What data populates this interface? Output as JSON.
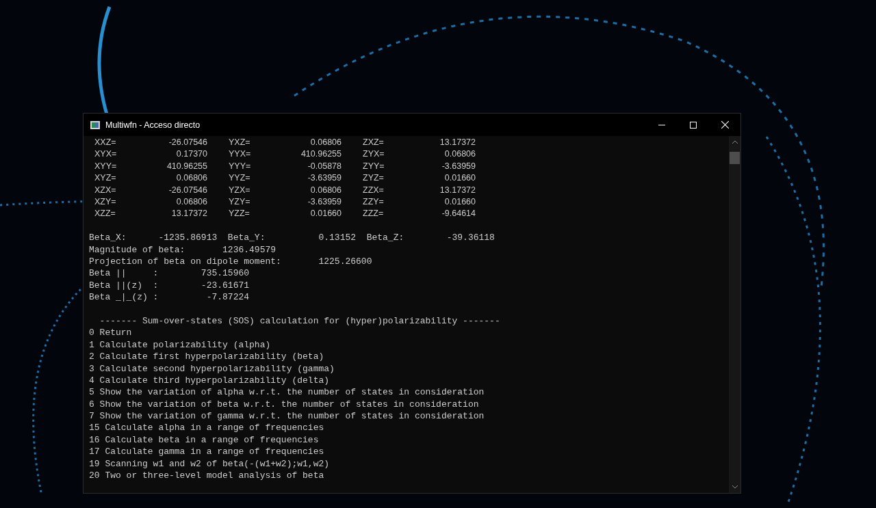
{
  "window": {
    "title": "Multiwfn - Acceso directo"
  },
  "console": {
    "tensor_rows": [
      [
        "XXZ=",
        "-26.07546",
        "YXZ=",
        "0.06806",
        "ZXZ=",
        "13.17372"
      ],
      [
        "XYX=",
        "0.17370",
        "YYX=",
        "410.96255",
        "ZYX=",
        "0.06806"
      ],
      [
        "XYY=",
        "410.96255",
        "YYY=",
        "-0.05878",
        "ZYY=",
        "-3.63959"
      ],
      [
        "XYZ=",
        "0.06806",
        "YYZ=",
        "-3.63959",
        "ZYZ=",
        "0.01660"
      ],
      [
        "XZX=",
        "-26.07546",
        "YZX=",
        "0.06806",
        "ZZX=",
        "13.17372"
      ],
      [
        "XZY=",
        "0.06806",
        "YZY=",
        "-3.63959",
        "ZZY=",
        "0.01660"
      ],
      [
        "XZZ=",
        "13.17372",
        "YZZ=",
        "0.01660",
        "ZZZ=",
        "-9.64614"
      ]
    ],
    "blocks": [
      [
        "Beta_X:      -1235.86913  Beta_Y:          0.13152  Beta_Z:        -39.36118",
        "Magnitude of beta:       1236.49579",
        "Projection of beta on dipole moment:       1225.26600",
        "Beta ||     :        735.15960",
        "Beta ||(z)  :        -23.61671",
        "Beta _|_(z) :         -7.87224"
      ],
      [
        "  ------- Sum-over-states (SOS) calculation for (hyper)polarizability -------",
        "0 Return",
        "1 Calculate polarizability (alpha)",
        "2 Calculate first hyperpolarizability (beta)",
        "3 Calculate second hyperpolarizability (gamma)",
        "4 Calculate third hyperpolarizability (delta)",
        "5 Show the variation of alpha w.r.t. the number of states in consideration",
        "6 Show the variation of beta w.r.t. the number of states in consideration",
        "7 Show the variation of gamma w.r.t. the number of states in consideration",
        "15 Calculate alpha in a range of frequencies",
        "16 Calculate beta in a range of frequencies",
        "17 Calculate gamma in a range of frequencies",
        "19 Scanning w1 and w2 of beta(-(w1+w2);w1,w2)",
        "20 Two or three-level model analysis of beta"
      ]
    ]
  }
}
